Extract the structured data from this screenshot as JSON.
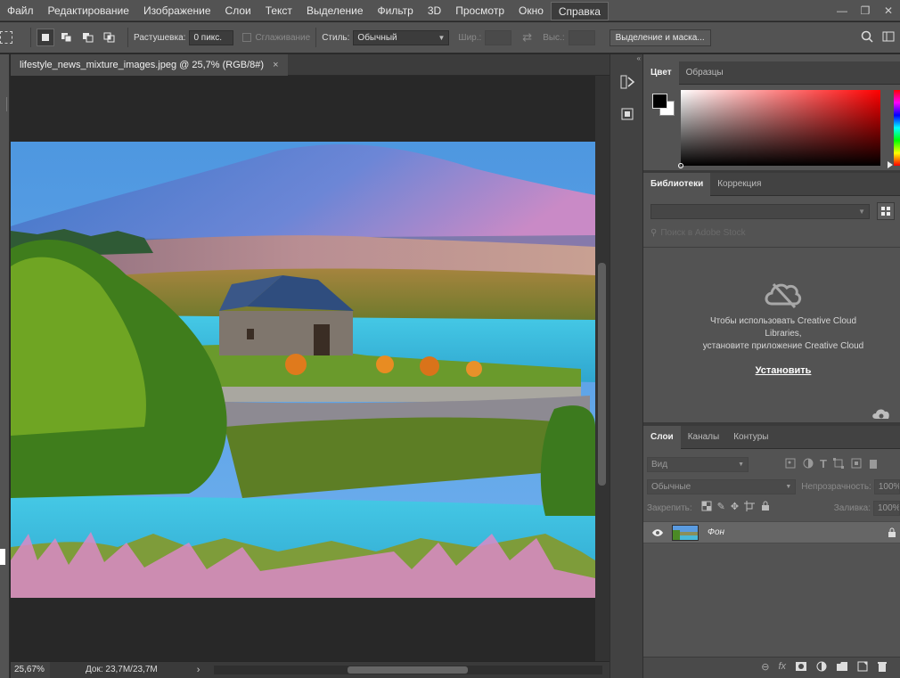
{
  "menu": {
    "items": [
      "Файл",
      "Редактирование",
      "Изображение",
      "Слои",
      "Текст",
      "Выделение",
      "Фильтр",
      "3D",
      "Просмотр",
      "Окно",
      "Справка"
    ],
    "active_index": 10
  },
  "options": {
    "feather_label": "Растушевка:",
    "feather_value": "0 пикс.",
    "antialias_label": "Сглаживание",
    "style_label": "Стиль:",
    "style_value": "Обычный",
    "width_label": "Шир.:",
    "height_label": "Выс.:",
    "select_mask_button": "Выделение и маска..."
  },
  "document": {
    "tab_title": "lifestyle_news_mixture_images.jpeg @ 25,7% (RGB/8#)",
    "close_glyph": "×"
  },
  "status": {
    "zoom": "25,67%",
    "doc_size": "Док: 23,7M/23,7M"
  },
  "color_panel": {
    "tabs": [
      "Цвет",
      "Образцы"
    ],
    "active_tab": 0,
    "foreground": "#000000",
    "background": "#ffffff"
  },
  "libraries_panel": {
    "tabs": [
      "Библиотеки",
      "Коррекция"
    ],
    "active_tab": 0,
    "search_placeholder": "Поиск в Adobe Stock",
    "message_line1": "Чтобы использовать Creative Cloud",
    "message_line2": "Libraries,",
    "message_line3": "установите приложение Creative Cloud",
    "install_link": "Установить"
  },
  "layers_panel": {
    "tabs": [
      "Слои",
      "Каналы",
      "Контуры"
    ],
    "active_tab": 0,
    "filter_label": "Вид",
    "blend_mode": "Обычные",
    "opacity_label": "Непрозрачность:",
    "opacity_value": "100%",
    "lock_label": "Закрепить:",
    "fill_label": "Заливка:",
    "fill_value": "100%",
    "layers": [
      {
        "name": "Фон",
        "visible": true,
        "locked": true
      }
    ]
  }
}
